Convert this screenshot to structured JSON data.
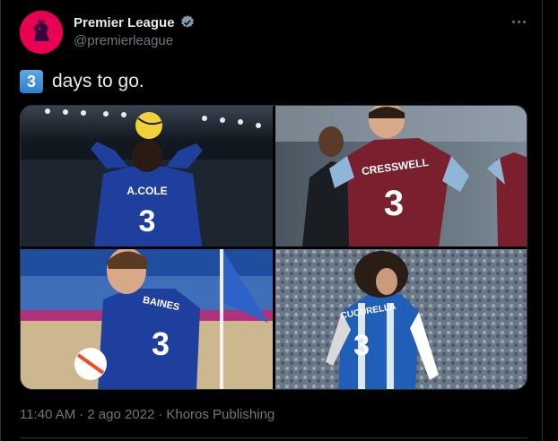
{
  "account": {
    "display_name": "Premier League",
    "handle": "@premierleague",
    "verified": true,
    "avatar_icon": "premier-league-lion-icon",
    "avatar_color": "#e90052"
  },
  "tweet": {
    "emoji_keycap": "3",
    "text": "days to go.",
    "photos": [
      {
        "jersey_name": "A.COLE",
        "jersey_number": "3",
        "shirt_color": "#1f3f9e"
      },
      {
        "jersey_name": "CRESSWELL",
        "jersey_number": "3",
        "shirt_color": "#7a1f2e"
      },
      {
        "jersey_name": "BAINES",
        "jersey_number": "3",
        "shirt_color": "#1f3f9e"
      },
      {
        "jersey_name": "CUCURELLA",
        "jersey_number": "3",
        "shirt_color": "#1f5fb8"
      }
    ]
  },
  "meta": {
    "time": "11:40 AM",
    "separator": "·",
    "date": "2 ago 2022",
    "source": "Khoros Publishing"
  },
  "more_icon": "more-horizontal-icon",
  "colors": {
    "background": "#000000",
    "text": "#e7e9ea",
    "secondary": "#71767b",
    "verified": "#829aab"
  }
}
